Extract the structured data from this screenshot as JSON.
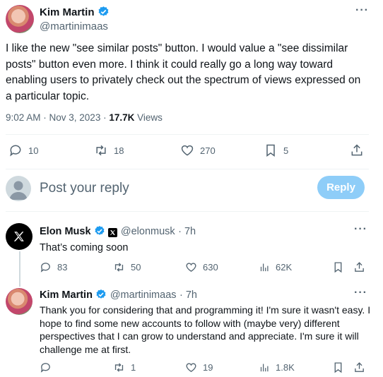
{
  "main_tweet": {
    "author_name": "Kim Martin",
    "author_handle": "@martinimaas",
    "text": "I like the new \"see similar posts\" button. I would value a \"see dissimilar posts\" button even more. I think it could really go a long way toward enabling users to privately check out the spectrum of views expressed on a particular topic.",
    "time": "9:02 AM · Nov 3, 2023 · ",
    "views_count": "17.7K",
    "views_label": " Views",
    "replies": "10",
    "reposts": "18",
    "likes": "270",
    "bookmarks": "5"
  },
  "composer": {
    "placeholder": "Post your reply",
    "reply_label": "Reply"
  },
  "replies": [
    {
      "author_name": "Elon Musk",
      "author_handle": "@elonmusk",
      "time": "· 7h",
      "text": "That’s coming soon",
      "replies": "83",
      "reposts": "50",
      "likes": "630",
      "views": "62K"
    },
    {
      "author_name": "Kim Martin",
      "author_handle": "@martinimaas",
      "time": "· 7h",
      "text": "Thank you for considering that and programming it!  I'm sure it wasn't easy. I hope to find some new accounts to follow with (maybe very) different perspectives that I can grow to understand and appreciate. I'm sure it will challenge me at first.",
      "replies": "",
      "reposts": "1",
      "likes": "19",
      "views": "1.8K"
    }
  ],
  "colors": {
    "accent": "#1d9bf0",
    "reply_button": "#8ecdf8",
    "muted": "#536471"
  }
}
